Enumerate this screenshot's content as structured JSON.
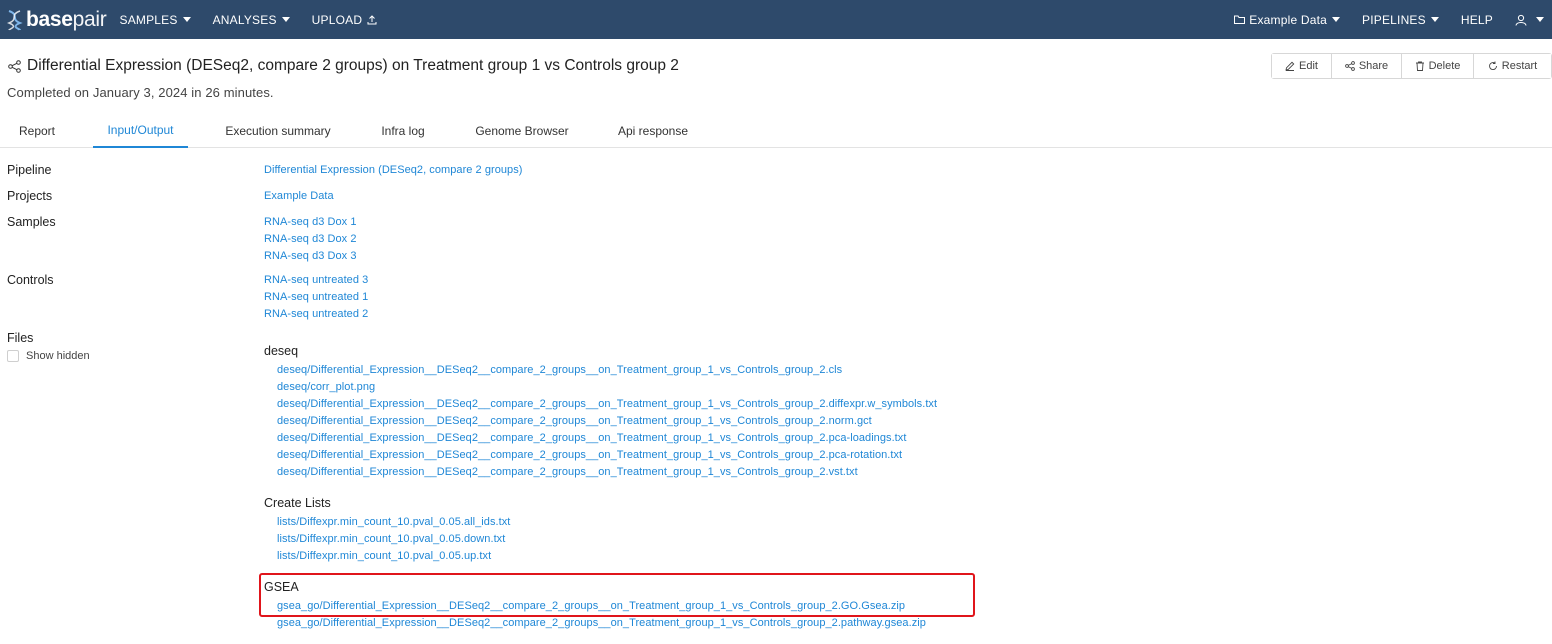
{
  "navbar": {
    "brand_bold": "base",
    "brand_light": "pair",
    "samples": "SAMPLES",
    "analyses": "ANALYSES",
    "upload": "UPLOAD",
    "example_data": "Example Data",
    "pipelines": "PIPELINES",
    "help": "HELP"
  },
  "header": {
    "title": "Differential Expression (DESeq2, compare 2 groups) on Treatment group 1 vs Controls group 2",
    "subtitle": "Completed on January 3, 2024 in 26 minutes."
  },
  "actions": {
    "edit": "Edit",
    "share": "Share",
    "delete": "Delete",
    "restart": "Restart"
  },
  "tabs": [
    "Report",
    "Input/Output",
    "Execution summary",
    "Infra log",
    "Genome Browser",
    "Api response"
  ],
  "details": {
    "pipeline_label": "Pipeline",
    "pipeline_value": "Differential Expression (DESeq2, compare 2 groups)",
    "projects_label": "Projects",
    "projects_value": "Example Data",
    "samples_label": "Samples",
    "samples": [
      "RNA-seq d3 Dox 1",
      "RNA-seq d3 Dox 2",
      "RNA-seq d3 Dox 3"
    ],
    "controls_label": "Controls",
    "controls": [
      "RNA-seq untreated 3",
      "RNA-seq untreated 1",
      "RNA-seq untreated 2"
    ],
    "files_label": "Files",
    "show_hidden": "Show hidden"
  },
  "files": {
    "deseq_title": "deseq",
    "deseq": [
      "deseq/Differential_Expression__DESeq2__compare_2_groups__on_Treatment_group_1_vs_Controls_group_2.cls",
      "deseq/corr_plot.png",
      "deseq/Differential_Expression__DESeq2__compare_2_groups__on_Treatment_group_1_vs_Controls_group_2.diffexpr.w_symbols.txt",
      "deseq/Differential_Expression__DESeq2__compare_2_groups__on_Treatment_group_1_vs_Controls_group_2.norm.gct",
      "deseq/Differential_Expression__DESeq2__compare_2_groups__on_Treatment_group_1_vs_Controls_group_2.pca-loadings.txt",
      "deseq/Differential_Expression__DESeq2__compare_2_groups__on_Treatment_group_1_vs_Controls_group_2.pca-rotation.txt",
      "deseq/Differential_Expression__DESeq2__compare_2_groups__on_Treatment_group_1_vs_Controls_group_2.vst.txt"
    ],
    "lists_title": "Create Lists",
    "lists": [
      "lists/Diffexpr.min_count_10.pval_0.05.all_ids.txt",
      "lists/Diffexpr.min_count_10.pval_0.05.down.txt",
      "lists/Diffexpr.min_count_10.pval_0.05.up.txt"
    ],
    "gsea_title": "GSEA",
    "gsea": [
      "gsea_go/Differential_Expression__DESeq2__compare_2_groups__on_Treatment_group_1_vs_Controls_group_2.GO.Gsea.zip",
      "gsea_go/Differential_Expression__DESeq2__compare_2_groups__on_Treatment_group_1_vs_Controls_group_2.pathway.gsea.zip"
    ]
  },
  "colors": {
    "navbar": "#2e4a6b",
    "link": "#1f87d6",
    "highlight": "#e0151b"
  }
}
